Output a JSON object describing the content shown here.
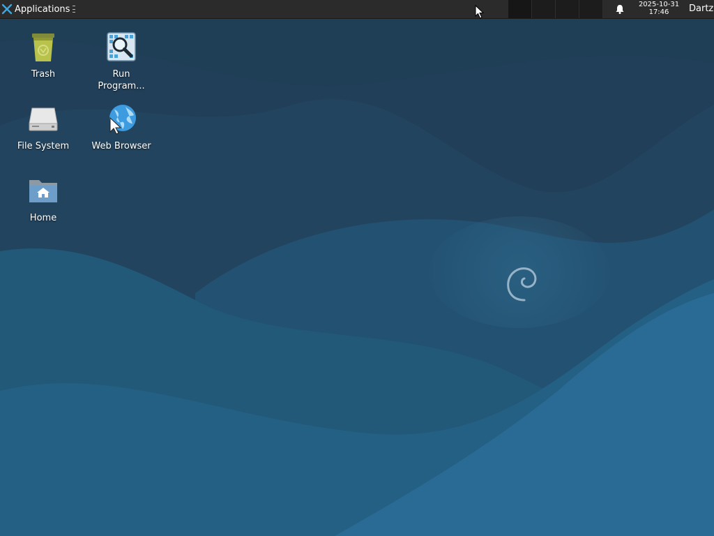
{
  "panel": {
    "applications_label": "Applications",
    "clock_date": "2025-10-31",
    "clock_time": "17:46",
    "user_label": "Dartz",
    "workspaces": [
      "",
      "",
      "",
      ""
    ]
  },
  "desktop": {
    "icons": [
      {
        "label": "Trash",
        "icon": "trash-icon"
      },
      {
        "label": "Run\nProgram...",
        "icon": "run-program-icon"
      },
      {
        "label": "File System",
        "icon": "drive-icon"
      },
      {
        "label": "Web Browser",
        "icon": "globe-icon"
      },
      {
        "label": "Home",
        "icon": "home-folder-icon"
      }
    ]
  },
  "colors": {
    "panel_bg": "#2b2b2b",
    "wallpaper_dark": "#1f3e55",
    "wallpaper_mid": "#22587a",
    "wallpaper_light": "#2a6a94"
  }
}
